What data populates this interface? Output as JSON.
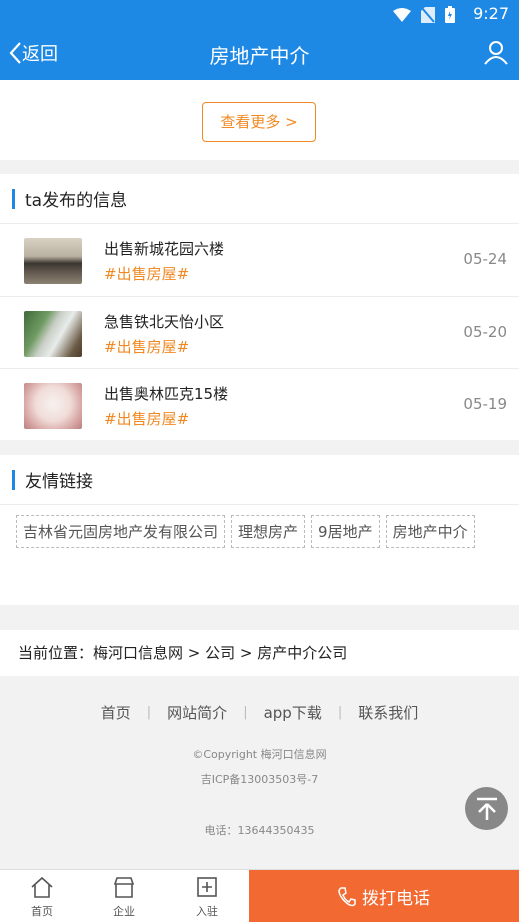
{
  "status_bar": {
    "time": "9:27"
  },
  "header": {
    "back_label": "返回",
    "title": "房地产中介"
  },
  "more": {
    "label": "查看更多 >"
  },
  "posts": {
    "heading": "ta发布的信息",
    "items": [
      {
        "title": "出售新城花园六楼",
        "tag": "#出售房屋#",
        "date": "05-24"
      },
      {
        "title": "急售铁北天怡小区",
        "tag": "#出售房屋#",
        "date": "05-20"
      },
      {
        "title": "出售奥林匹克15楼",
        "tag": "#出售房屋#",
        "date": "05-19"
      }
    ]
  },
  "friend_links": {
    "heading": "友情链接",
    "items": [
      "吉林省元固房地产发有限公司",
      "理想房产",
      "9居地产",
      "房地产中介"
    ]
  },
  "breadcrumb": {
    "text": "当前位置：梅河口信息网 > 公司 > 房产中介公司"
  },
  "footer": {
    "nav": [
      "首页",
      "网站简介",
      "app下载",
      "联系我们"
    ],
    "copyright": "©Copyright  梅河口信息网",
    "icp": "吉ICP备13003503号-7",
    "phone": "电话：13644350435"
  },
  "bottom_nav": {
    "tabs": [
      "首页",
      "企业",
      "入驻"
    ],
    "call_label": "拨打电话"
  },
  "colors": {
    "primary": "#1e88e5",
    "accent": "#f08a24",
    "call": "#f26a32"
  }
}
